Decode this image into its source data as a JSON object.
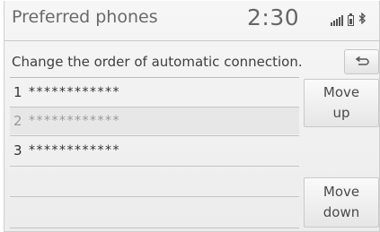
{
  "header": {
    "title": "Preferred phones",
    "clock": "2:30",
    "status_icons": [
      "signal-icon",
      "battery-icon",
      "bluetooth-icon"
    ]
  },
  "instruction": "Change the order of automatic connection.",
  "back_button": {
    "icon": "back-arrow-icon"
  },
  "phones": [
    {
      "number": "1",
      "name": "************",
      "selected": false
    },
    {
      "number": "2",
      "name": "************",
      "selected": true
    },
    {
      "number": "3",
      "name": "************",
      "selected": false
    }
  ],
  "buttons": {
    "move_up_line1": "Move",
    "move_up_line2": "up",
    "move_down_line1": "Move",
    "move_down_line2": "down"
  },
  "colors": {
    "background": "#f1f1f1",
    "selected_row": "#e7e7e7",
    "text": "#333333"
  }
}
